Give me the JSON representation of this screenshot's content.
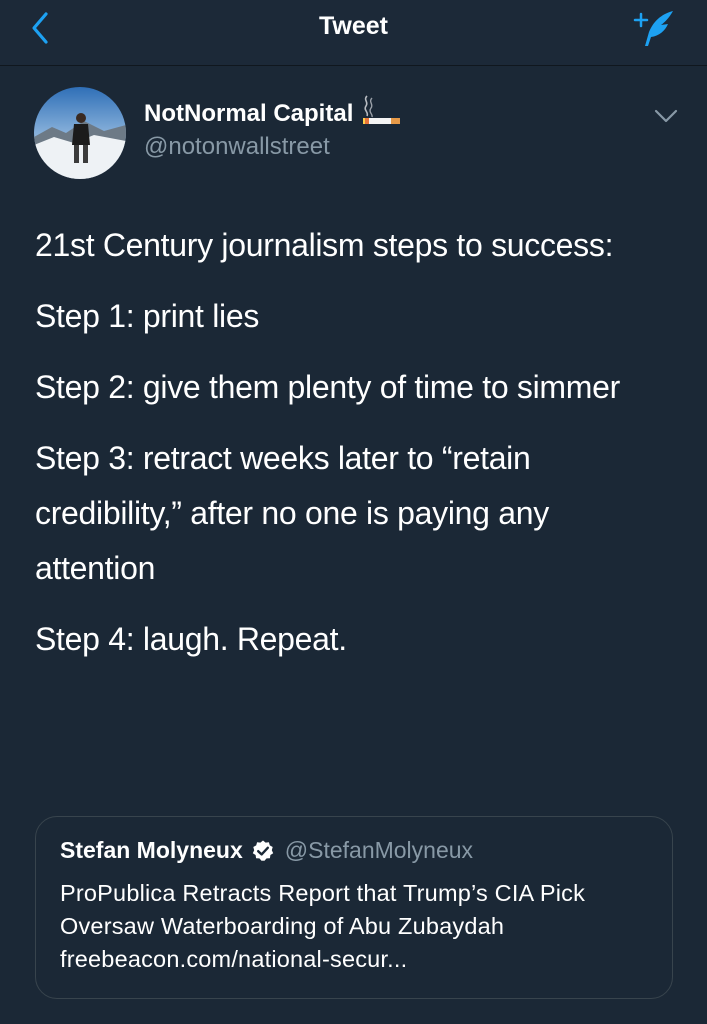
{
  "header": {
    "title": "Tweet"
  },
  "author": {
    "display_name": "NotNormal Capital",
    "handle": "@notonwallstreet"
  },
  "tweet": {
    "paragraphs": [
      "21st Century journalism steps to success:",
      "Step 1: print lies",
      "Step 2: give them plenty of time to simmer",
      "Step 3: retract weeks later to “retain credibility,” after no one is paying any attention",
      "Step 4: laugh. Repeat."
    ]
  },
  "quoted_tweet": {
    "display_name": "Stefan Molyneux",
    "handle": "@StefanMolyneux",
    "text": "ProPublica Retracts Report that Trump’s CIA Pick Oversaw Waterboarding of Abu Zubaydah freebeacon.com/national-secur..."
  },
  "icons": {
    "back": "chevron-left-icon",
    "compose": "compose-tweet-icon",
    "caret": "chevron-down-icon",
    "verified": "verified-badge-icon",
    "emoji": "cigarette-emoji"
  },
  "colors": {
    "background": "#1b2836",
    "accent": "#1da1f2",
    "secondary_text": "#8899a6",
    "border": "#38444d"
  }
}
